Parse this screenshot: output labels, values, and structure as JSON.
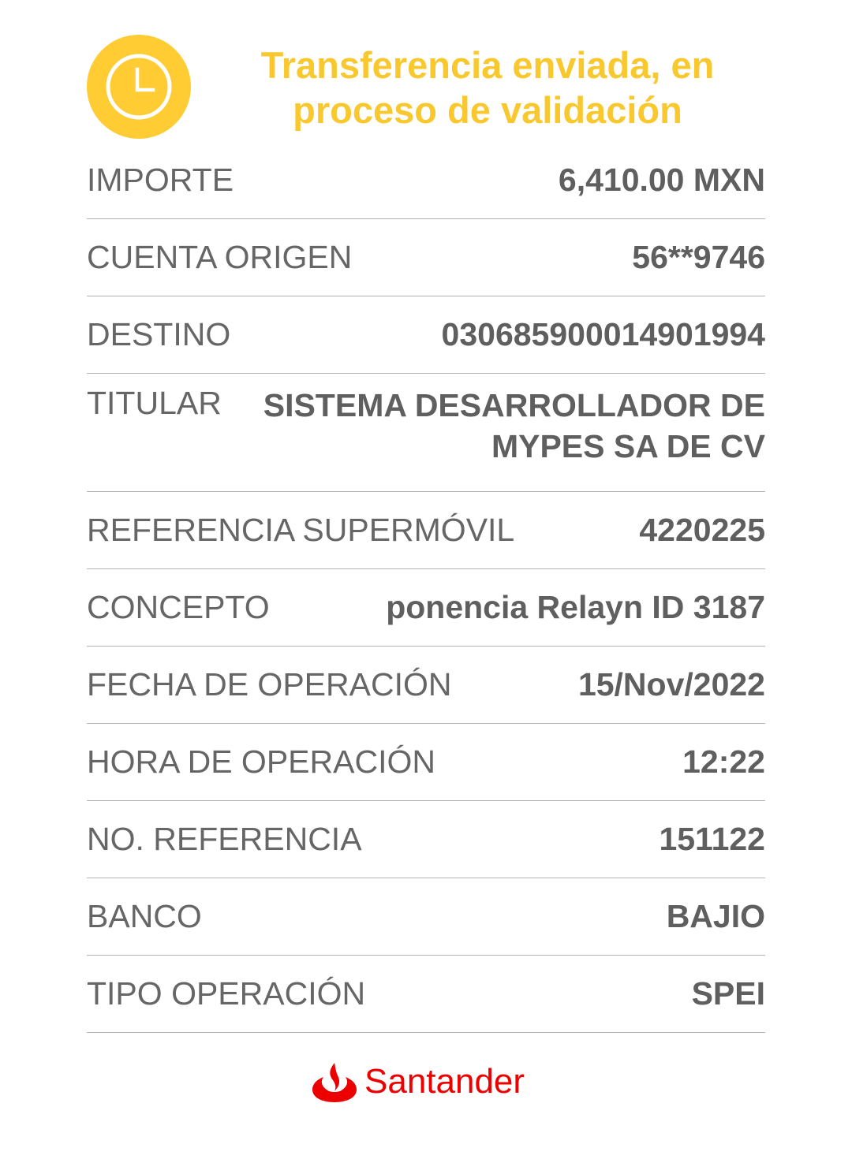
{
  "header": {
    "title": "Transferencia enviada, en proceso de validación",
    "icon": "clock-icon",
    "accent_color": "#f9c82f"
  },
  "details": [
    {
      "label": "IMPORTE",
      "value": "6,410.00 MXN"
    },
    {
      "label": "CUENTA ORIGEN",
      "value": "56**9746"
    },
    {
      "label": "DESTINO",
      "value": "030685900014901994"
    },
    {
      "label": "TITULAR",
      "value": "SISTEMA DESARROLLADOR DE MYPES SA DE CV"
    },
    {
      "label": "REFERENCIA SUPERMÓVIL",
      "value": "4220225"
    },
    {
      "label": "CONCEPTO",
      "value": "ponencia Relayn ID 3187"
    },
    {
      "label": "FECHA DE OPERACIÓN",
      "value": "15/Nov/2022"
    },
    {
      "label": "HORA DE OPERACIÓN",
      "value": "12:22"
    },
    {
      "label": "NO. REFERENCIA",
      "value": "151122"
    },
    {
      "label": "BANCO",
      "value": "BAJIO"
    },
    {
      "label": "TIPO OPERACIÓN",
      "value": "SPEI"
    }
  ],
  "brand": {
    "name": "Santander",
    "icon": "santander-flame-icon",
    "color": "#ec0000"
  }
}
